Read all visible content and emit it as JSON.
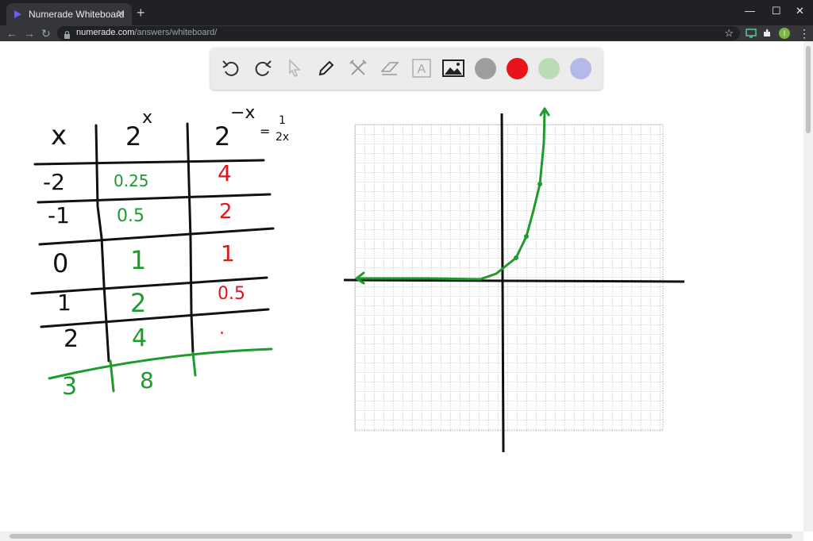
{
  "browser": {
    "tab_title": "Numerade Whiteboard",
    "tab_close": "✕",
    "new_tab": "+",
    "window_controls": {
      "minimize": "—",
      "maximize": "☐",
      "close": "✕"
    },
    "nav": {
      "back": "←",
      "forward": "→",
      "reload": "↻"
    },
    "url_host": "numerade.com",
    "url_path": "/answers/whiteboard/",
    "bookmark": "☆",
    "profile_initial": "I",
    "menu": "⋮"
  },
  "whiteboard_toolbar": {
    "tools": [
      "undo-icon",
      "redo-icon",
      "pointer-icon",
      "pen-icon",
      "tools-icon",
      "eraser-icon",
      "text-icon",
      "image-icon"
    ],
    "text_tool_glyph": "A",
    "swatches": [
      "#9e9e9e",
      "#e8131b",
      "#b9dcb4",
      "#b5b8ea"
    ]
  },
  "handwriting": {
    "headers": [
      "x",
      "2",
      "x",
      "2",
      "−x",
      "= ",
      "1",
      "2x"
    ],
    "x_values": [
      "-2",
      "-1",
      "0",
      "1",
      "2",
      "3"
    ],
    "col_2x": [
      "0.25",
      "0.5",
      "1",
      "2",
      "4",
      "8"
    ],
    "col_2negx": [
      "4",
      "2",
      "1",
      "0.5",
      "."
    ]
  },
  "colors": {
    "ink": "#111111",
    "green": "#1f9a2e",
    "red": "#e3141b",
    "grid": "#9a9a9a"
  }
}
